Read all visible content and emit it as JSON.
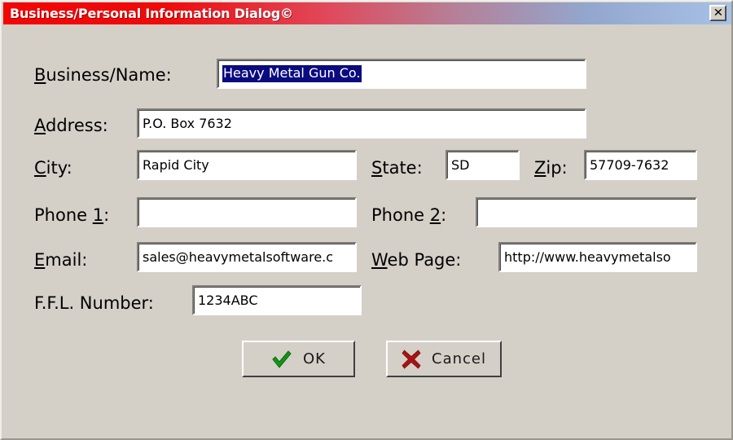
{
  "window": {
    "title": "Business/Personal Information Dialog©",
    "close_label": "✕",
    "titlebar_gradient_start": "#f20505",
    "titlebar_gradient_end": "#a6c2e6",
    "body_color": "#d4d0c8",
    "selection_color": "#0b0b80"
  },
  "fields": {
    "business_name": {
      "label_pre": "",
      "label_accel": "B",
      "label_post": "usiness/Name:",
      "value": "Heavy Metal Gun Co.",
      "placeholder": ""
    },
    "address": {
      "label_pre": "",
      "label_accel": "A",
      "label_post": "ddress:",
      "value": "P.O. Box 7632",
      "placeholder": ""
    },
    "city": {
      "label_pre": "",
      "label_accel": "C",
      "label_post": "ity:",
      "value": "Rapid City",
      "placeholder": ""
    },
    "state": {
      "label_pre": "",
      "label_accel": "S",
      "label_post": "tate:",
      "value": "SD",
      "placeholder": ""
    },
    "zip": {
      "label_pre": "",
      "label_accel": "Z",
      "label_post": "ip:",
      "value": "57709-7632",
      "placeholder": ""
    },
    "phone1": {
      "label_pre": "Phone ",
      "label_accel": "1",
      "label_post": ":",
      "value": "",
      "placeholder": ""
    },
    "phone2": {
      "label_pre": "Phone ",
      "label_accel": "2",
      "label_post": ":",
      "value": "",
      "placeholder": ""
    },
    "email": {
      "label_pre": "",
      "label_accel": "E",
      "label_post": "mail:",
      "value": "sales@heavymetalsoftware.c",
      "placeholder": ""
    },
    "web_page": {
      "label_pre": "",
      "label_accel": "W",
      "label_post": "eb Page:",
      "value": "http://www.heavymetalso",
      "placeholder": ""
    },
    "ffl_number": {
      "label_pre": "F.F.L. Number:",
      "label_accel": "",
      "label_post": "",
      "value": "1234ABC",
      "placeholder": ""
    }
  },
  "buttons": {
    "ok": {
      "label": "OK",
      "icon": "check-icon",
      "icon_color": "#159415"
    },
    "cancel": {
      "label": "Cancel",
      "icon": "cross-icon",
      "icon_color": "#a61414"
    }
  }
}
